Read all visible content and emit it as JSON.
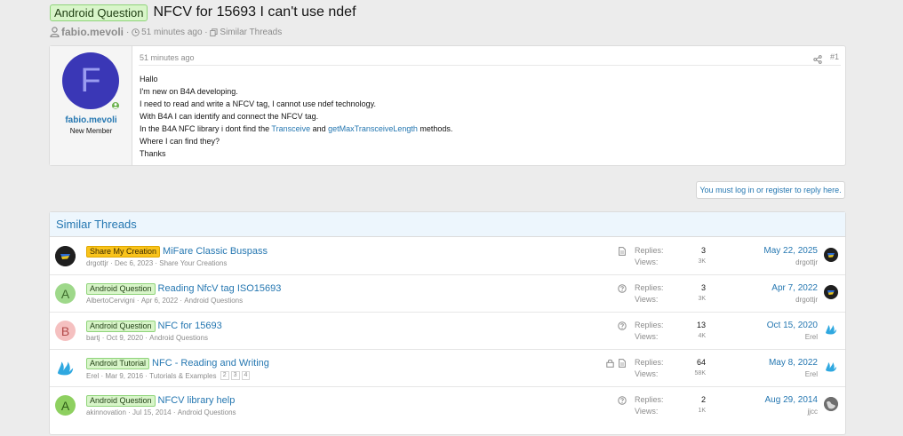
{
  "thread": {
    "prefix": "Android Question",
    "title": "NFCV for 15693 I can't use ndef",
    "author": "fabio.mevoli",
    "time": "51 minutes ago",
    "similar_link": "Similar Threads"
  },
  "post": {
    "username": "fabio.mevoli",
    "role": "New Member",
    "avatar_letter": "F",
    "date": "51 minutes ago",
    "number": "#1",
    "lines": {
      "l1": "Hallo",
      "l2": "I'm new on B4A developing.",
      "l3": "I need to read and write a NFCV tag, I cannot use ndef technology.",
      "l4": "With B4A I can identify and connect the NFCV tag.",
      "l5_a": "In the B4A NFC library i dont find the ",
      "l5_link1": "Transceive",
      "l5_b": " and ",
      "l5_link2": "getMaxTransceiveLength",
      "l5_c": " methods.",
      "l6": "Where I can find they?",
      "l7": "Thanks"
    }
  },
  "login_prompt": "You must log in or register to reply here.",
  "similar": {
    "heading": "Similar Threads",
    "stat_labels": {
      "replies": "Replies:",
      "views": "Views:"
    },
    "rows": [
      {
        "avatar_letter": "",
        "prefix": "Share My Creation",
        "title": "MiFare Classic Buspass",
        "author": "drgottjr",
        "date": "Dec 6, 2023",
        "forum": "Share Your Creations",
        "replies": "3",
        "views": "3K",
        "last_date": "May 22, 2025",
        "last_user": "drgottjr"
      },
      {
        "avatar_letter": "A",
        "prefix": "Android Question",
        "title": "Reading NfcV tag ISO15693",
        "author": "AlbertoCervigni",
        "date": "Apr 6, 2022",
        "forum": "Android Questions",
        "replies": "3",
        "views": "3K",
        "last_date": "Apr 7, 2022",
        "last_user": "drgottjr"
      },
      {
        "avatar_letter": "B",
        "prefix": "Android Question",
        "title": "NFC for 15693",
        "author": "bartj",
        "date": "Oct 9, 2020",
        "forum": "Android Questions",
        "replies": "13",
        "views": "4K",
        "last_date": "Oct 15, 2020",
        "last_user": "Erel"
      },
      {
        "avatar_letter": "",
        "prefix": "Android Tutorial",
        "title": "NFC - Reading and Writing",
        "author": "Erel",
        "date": "Mar 9, 2016",
        "forum": "Tutorials & Examples",
        "pages": [
          "2",
          "3",
          "4"
        ],
        "replies": "64",
        "views": "58K",
        "last_date": "May 8, 2022",
        "last_user": "Erel"
      },
      {
        "avatar_letter": "A",
        "prefix": "Android Question",
        "title": "NFCV library help",
        "author": "akinnovation",
        "date": "Jul 15, 2014",
        "forum": "Android Questions",
        "replies": "2",
        "views": "1K",
        "last_date": "Aug 29, 2014",
        "last_user": "jjcc"
      }
    ]
  },
  "icons": {
    "user": "user-icon",
    "clock": "clock-icon",
    "copy": "copy-icon",
    "share": "share-icon",
    "doc": "document-icon",
    "question": "question-icon",
    "lock": "lock-icon",
    "b4x_logo": "b4x-flame-icon",
    "earth": "earth-icon"
  },
  "colors": {
    "link": "#2577b1",
    "label_green_bg": "#d8f5c9",
    "label_orange_bg": "#f9c31b",
    "avatar_blue": "#3a37b6",
    "avatar_green": "#8ed060",
    "avatar_pink": "#f5c0c0"
  }
}
